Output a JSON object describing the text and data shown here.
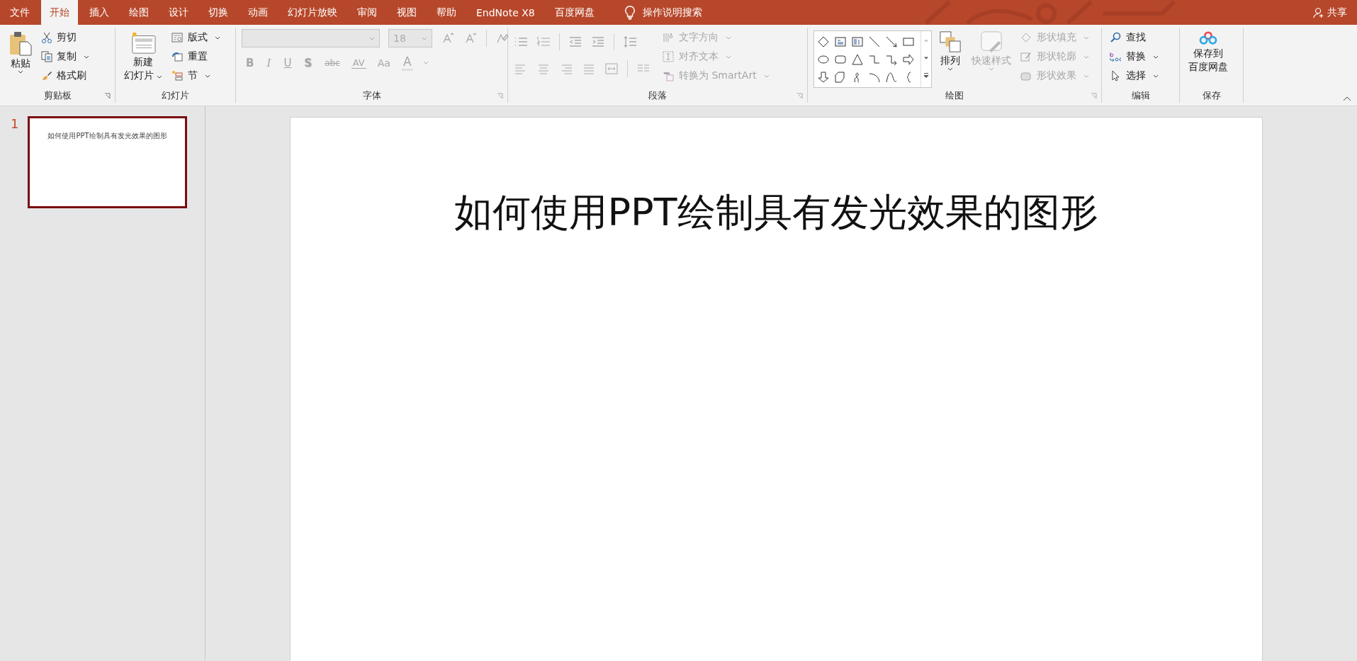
{
  "tabs": [
    {
      "label": "文件",
      "selected": false
    },
    {
      "label": "开始",
      "selected": true
    },
    {
      "label": "插入",
      "selected": false
    },
    {
      "label": "绘图",
      "selected": false
    },
    {
      "label": "设计",
      "selected": false
    },
    {
      "label": "切换",
      "selected": false
    },
    {
      "label": "动画",
      "selected": false
    },
    {
      "label": "幻灯片放映",
      "selected": false
    },
    {
      "label": "审阅",
      "selected": false
    },
    {
      "label": "视图",
      "selected": false
    },
    {
      "label": "帮助",
      "selected": false
    },
    {
      "label": "EndNote X8",
      "selected": false
    },
    {
      "label": "百度网盘",
      "selected": false
    }
  ],
  "tell_me": "操作说明搜索",
  "share": "共享",
  "clipboard": {
    "label": "剪贴板",
    "paste": "粘贴",
    "items": [
      {
        "label": "剪切",
        "kind": "cut",
        "dropdown": false
      },
      {
        "label": "复制",
        "kind": "copy",
        "dropdown": true
      },
      {
        "label": "格式刷",
        "kind": "brush",
        "dropdown": false
      }
    ]
  },
  "slides_group": {
    "label": "幻灯片",
    "new_slide": [
      "新建",
      "幻灯片"
    ],
    "items": [
      {
        "label": "版式",
        "kind": "layout",
        "dropdown": true
      },
      {
        "label": "重置",
        "kind": "reset",
        "dropdown": false
      },
      {
        "label": "节",
        "kind": "section",
        "dropdown": true
      }
    ]
  },
  "font": {
    "label": "字体",
    "disabled": true,
    "font_size": "18",
    "buttons": [
      {
        "label": "B",
        "kind": "bold"
      },
      {
        "label": "I",
        "kind": "italic"
      },
      {
        "label": "U",
        "kind": "underline"
      },
      {
        "label": "S",
        "kind": "shadow"
      },
      {
        "label": "abc",
        "kind": "strike"
      },
      {
        "label": "AV",
        "kind": "spacing"
      },
      {
        "label": "Aa",
        "kind": "case"
      },
      {
        "label": "A",
        "kind": "color"
      }
    ]
  },
  "paragraph": {
    "label": "段落",
    "items": [
      {
        "label": "文字方向",
        "kind": "direction",
        "disabled": true
      },
      {
        "label": "对齐文本",
        "kind": "align",
        "disabled": true
      },
      {
        "label": "转换为 SmartArt",
        "kind": "smartart",
        "disabled": true
      }
    ]
  },
  "drawing": {
    "label": "绘图",
    "arrange": "排列",
    "quick_styles": {
      "label": "快速样式",
      "disabled": true
    },
    "items": [
      {
        "label": "形状填充",
        "kind": "fill",
        "disabled": true
      },
      {
        "label": "形状轮廓",
        "kind": "outline",
        "disabled": true
      },
      {
        "label": "形状效果",
        "kind": "effect",
        "disabled": true
      }
    ]
  },
  "editing": {
    "label": "编辑",
    "items": [
      {
        "label": "查找",
        "kind": "find",
        "dropdown": false
      },
      {
        "label": "替换",
        "kind": "replace",
        "dropdown": true
      },
      {
        "label": "选择",
        "kind": "select",
        "dropdown": true
      }
    ]
  },
  "save": {
    "label": "保存",
    "button": [
      "保存到",
      "百度网盘"
    ]
  },
  "thumbnails": [
    {
      "number": "1",
      "title": "如何使用PPT绘制具有发光效果的图形",
      "selected": true
    }
  ],
  "slide": {
    "title": "如何使用PPT绘制具有发光效果的图形"
  }
}
